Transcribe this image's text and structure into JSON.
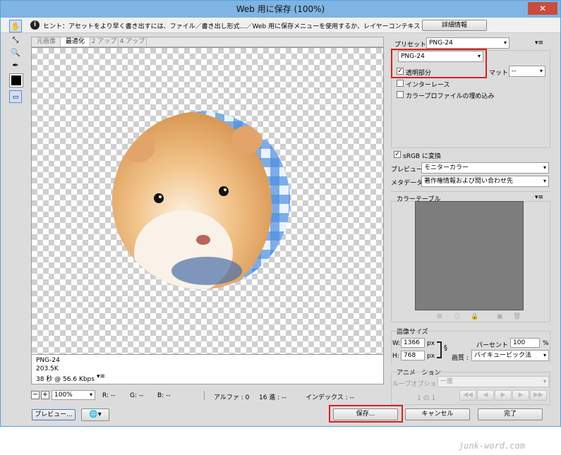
{
  "window": {
    "title": "Web 用に保存 (100%)",
    "close": "✕"
  },
  "hint": {
    "text": "ヒント：アセットをより早く書き出すには、ファイル／書き出し形式…／Web 用に保存メニューを使用するか、レイヤーコンテキストメニューを使用。",
    "details_button": "詳細情報"
  },
  "tabs": [
    "元画像",
    "最適化",
    "2 アップ",
    "4 アップ"
  ],
  "preview_info": {
    "format": "PNG-24",
    "size": "203.5K",
    "time": "38 秒 @ 56.6 Kbps"
  },
  "settings": {
    "preset_label": "プリセット :",
    "preset_value": "PNG-24",
    "format_value": "PNG-24",
    "transparency_label": "透明部分",
    "transparency_checked": true,
    "matte_label": "マット :",
    "matte_value": "--",
    "interlace_label": "インターレース",
    "embed_profile_label": "カラープロファイルの埋め込み",
    "srgb_label": "sRGB に変換",
    "srgb_checked": true,
    "preview_label": "プレビュー :",
    "preview_value": "モニターカラー",
    "metadata_label": "メタデータ :",
    "metadata_value": "著作権情報および問い合わせ先"
  },
  "color_table": {
    "title": "カラーテーブル"
  },
  "image_size": {
    "title": "画像サイズ",
    "w_label": "W:",
    "w_value": "1366",
    "h_label": "H:",
    "h_value": "768",
    "unit": "px",
    "percent_label": "パーセント :",
    "percent_value": "100",
    "percent_unit": "%",
    "quality_label": "画質 :",
    "quality_value": "バイキュービック法"
  },
  "animation": {
    "title": "アニメーション",
    "loop_label": "ループオプション :",
    "loop_value": "一度",
    "frame": "1 の 1"
  },
  "statusbar": {
    "zoom": "100%",
    "r": "R: --",
    "g": "G: --",
    "b": "B: --",
    "alpha": "アルファ : 0",
    "hex": "16 進 : --",
    "index": "インデックス : --"
  },
  "buttons": {
    "preview": "プレビュー...",
    "save": "保存...",
    "cancel": "キャンセル",
    "done": "完了"
  },
  "watermark": "junk-word.com"
}
